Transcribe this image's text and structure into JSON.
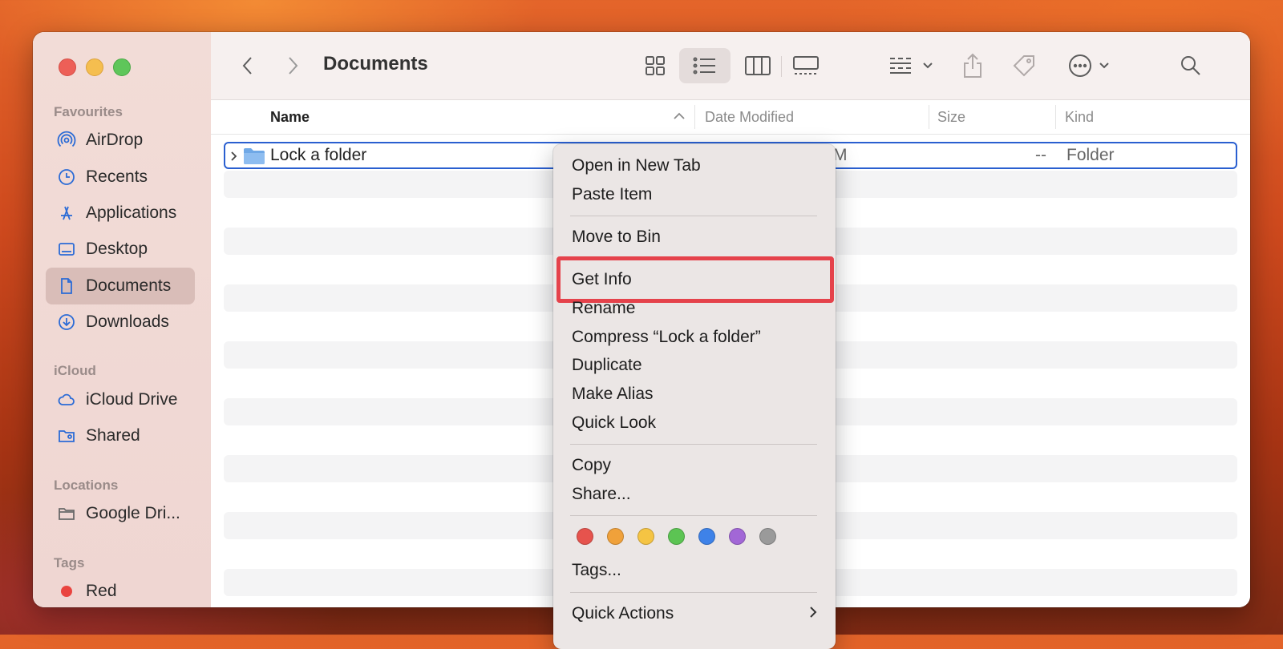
{
  "window": {
    "title": "Documents"
  },
  "sidebar": {
    "sections": {
      "favourites": "Favourites",
      "icloud": "iCloud",
      "locations": "Locations",
      "tags": "Tags"
    },
    "favourites": [
      {
        "label": "AirDrop",
        "icon": "airdrop-icon"
      },
      {
        "label": "Recents",
        "icon": "clock-icon"
      },
      {
        "label": "Applications",
        "icon": "applications-icon"
      },
      {
        "label": "Desktop",
        "icon": "desktop-icon"
      },
      {
        "label": "Documents",
        "icon": "document-icon",
        "active": true
      },
      {
        "label": "Downloads",
        "icon": "download-icon"
      }
    ],
    "icloud": [
      {
        "label": "iCloud Drive",
        "icon": "cloud-icon"
      },
      {
        "label": "Shared",
        "icon": "shared-folder-icon"
      }
    ],
    "locations": [
      {
        "label": "Google Dri...",
        "icon": "folder-icon"
      }
    ],
    "tags": [
      {
        "label": "Red",
        "color": "#e9443f"
      }
    ]
  },
  "columns": {
    "name": "Name",
    "date_modified": "Date Modified",
    "size": "Size",
    "kind": "Kind"
  },
  "files": [
    {
      "name": "Lock a folder",
      "date_partial": "M",
      "size": "--",
      "kind": "Folder"
    }
  ],
  "context_menu": {
    "items": {
      "open_new_tab": "Open in New Tab",
      "paste_item": "Paste Item",
      "move_to_bin": "Move to Bin",
      "get_info": "Get Info",
      "rename": "Rename",
      "compress": "Compress “Lock a folder”",
      "duplicate": "Duplicate",
      "make_alias": "Make Alias",
      "quick_look": "Quick Look",
      "copy": "Copy",
      "share": "Share...",
      "tags": "Tags...",
      "quick_actions": "Quick Actions"
    },
    "tag_colors": [
      "#e6534d",
      "#f0a13a",
      "#f5c443",
      "#5cc453",
      "#3e82e8",
      "#a267d6",
      "#9a9a9a"
    ],
    "highlight_color": "#e5424b"
  }
}
